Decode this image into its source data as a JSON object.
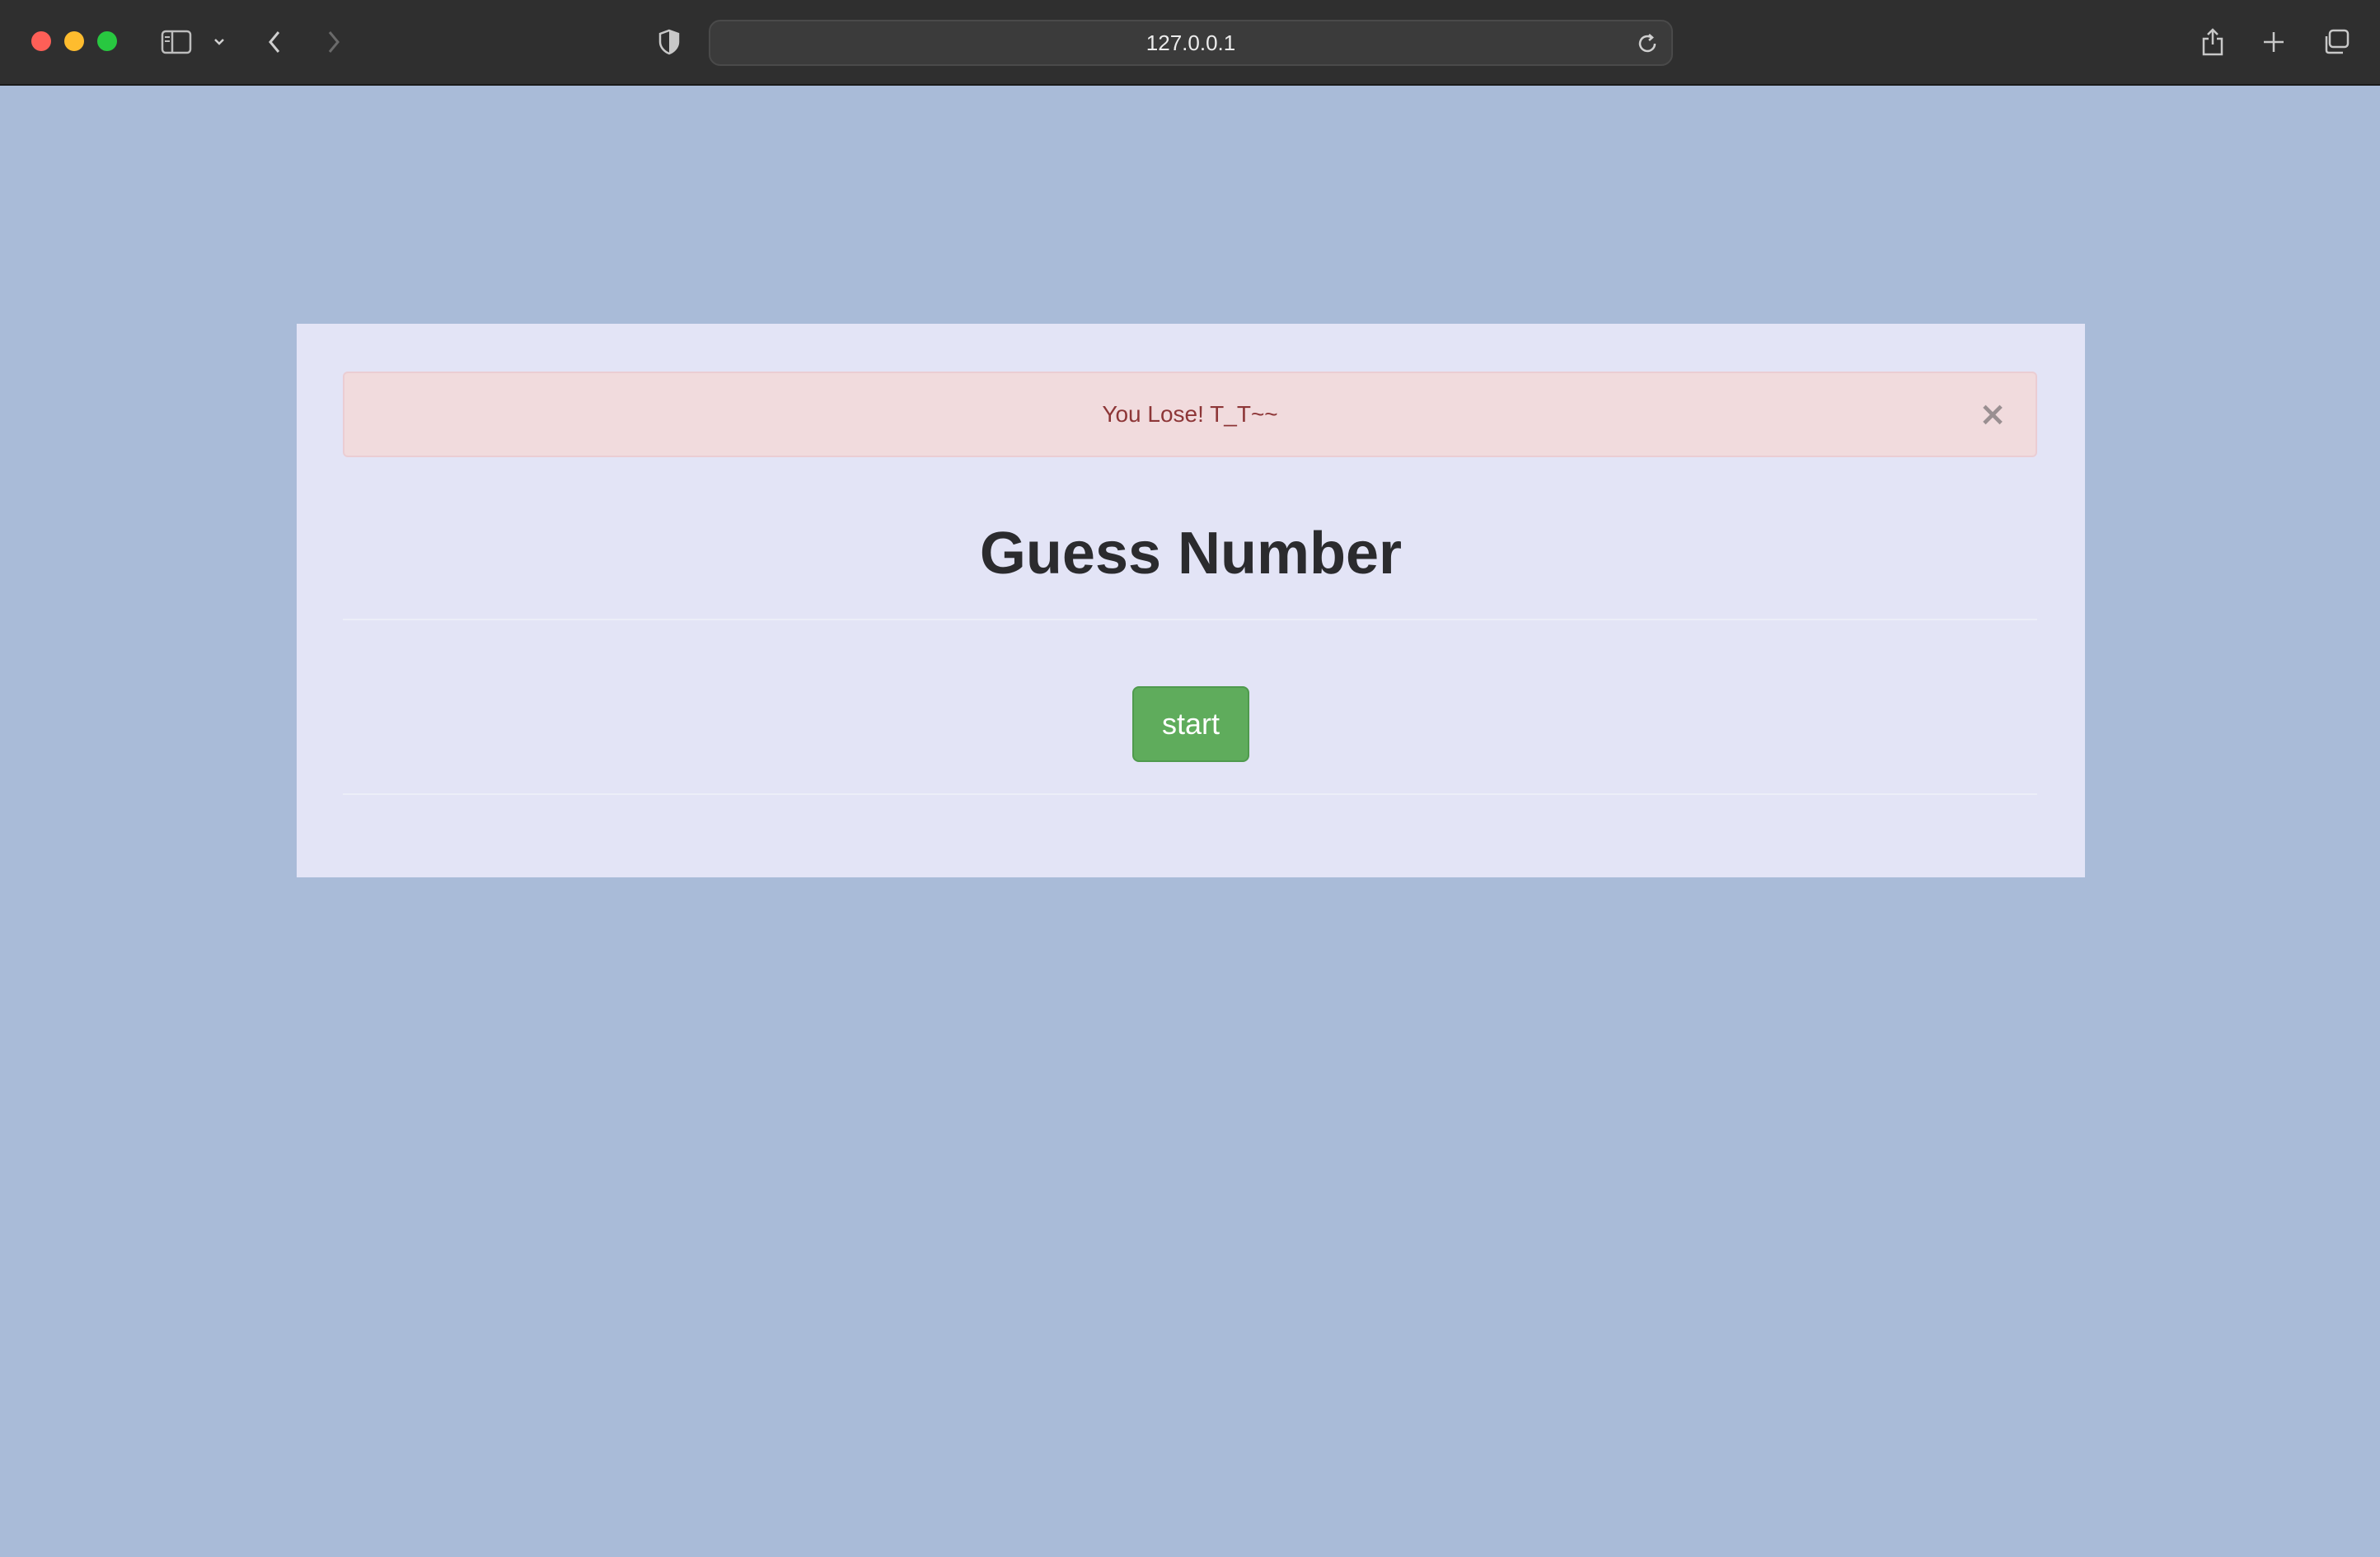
{
  "browser": {
    "address": "127.0.0.1",
    "icons": {
      "sidebar": "sidebar-icon",
      "chevron": "chevron-down-icon",
      "back": "back-icon",
      "forward": "forward-icon",
      "shield": "shield-icon",
      "reload": "reload-icon",
      "share": "share-icon",
      "new_tab": "plus-icon",
      "tabs": "tabs-overview-icon"
    }
  },
  "page": {
    "alert": {
      "message": "You Lose! T_T~~",
      "close_label": "×"
    },
    "title": "Guess Number",
    "start_label": "start"
  },
  "colors": {
    "background": "#a9bbd8",
    "panel": "#e3e4f6",
    "alert_bg": "#f1dbdd",
    "alert_text": "#8d3637",
    "button": "#5fac5c"
  }
}
